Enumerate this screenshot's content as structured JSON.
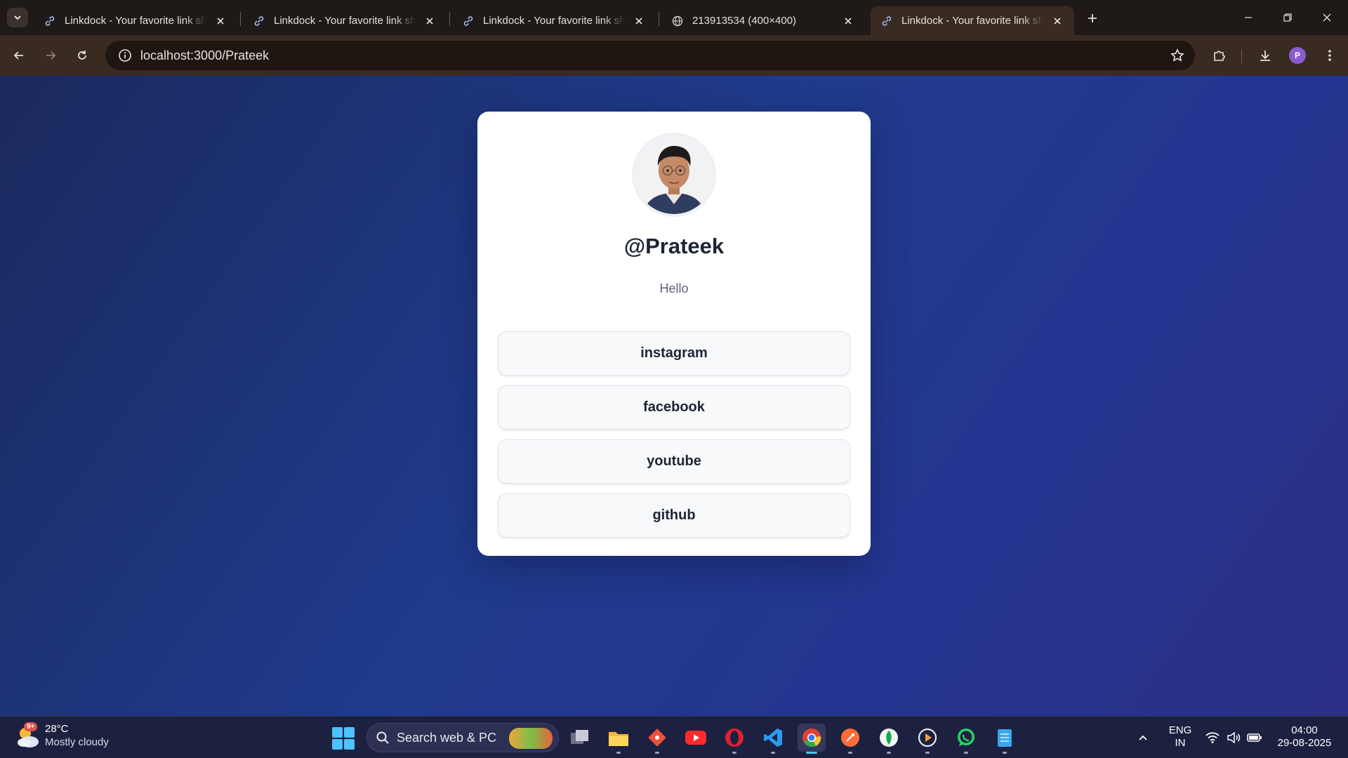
{
  "browser": {
    "tabs": [
      {
        "title": "Linkdock - Your favorite link sha",
        "icon": "link-icon",
        "active": false
      },
      {
        "title": "Linkdock - Your favorite link sha",
        "icon": "link-icon",
        "active": false
      },
      {
        "title": "Linkdock - Your favorite link sha",
        "icon": "link-icon",
        "active": false
      },
      {
        "title": "213913534 (400×400)",
        "icon": "globe-icon",
        "active": false
      },
      {
        "title": "Linkdock - Your favorite link sha",
        "icon": "link-icon",
        "active": true
      }
    ],
    "url": "localhost:3000/Prateek",
    "profile_initial": "P",
    "colors": {
      "tabstrip": "#1f1a17",
      "toolbar": "#3a2b22",
      "profile": "#8a5ccf"
    }
  },
  "page": {
    "handle": "@Prateek",
    "bio": "Hello",
    "links": [
      "instagram",
      "facebook",
      "youtube",
      "github"
    ],
    "colors": {
      "background_start": "#1b2a5e",
      "background_end": "#2a2f86",
      "card": "#ffffff",
      "button": "#f8f9fb",
      "text": "#1d2433"
    }
  },
  "taskbar": {
    "weather": {
      "badge": "9+",
      "temp": "28°C",
      "condition": "Mostly cloudy"
    },
    "search_placeholder": "Search web & PC",
    "apps": [
      "task-view",
      "file-explorer",
      "git-app",
      "youtube",
      "opera",
      "vscode",
      "chrome",
      "postman",
      "mongodb-compass",
      "media-player",
      "whatsapp",
      "notepad"
    ],
    "active_app": "chrome",
    "tray": {
      "language": "ENG",
      "region": "IN",
      "time": "04:00",
      "date": "29-08-2025"
    }
  }
}
